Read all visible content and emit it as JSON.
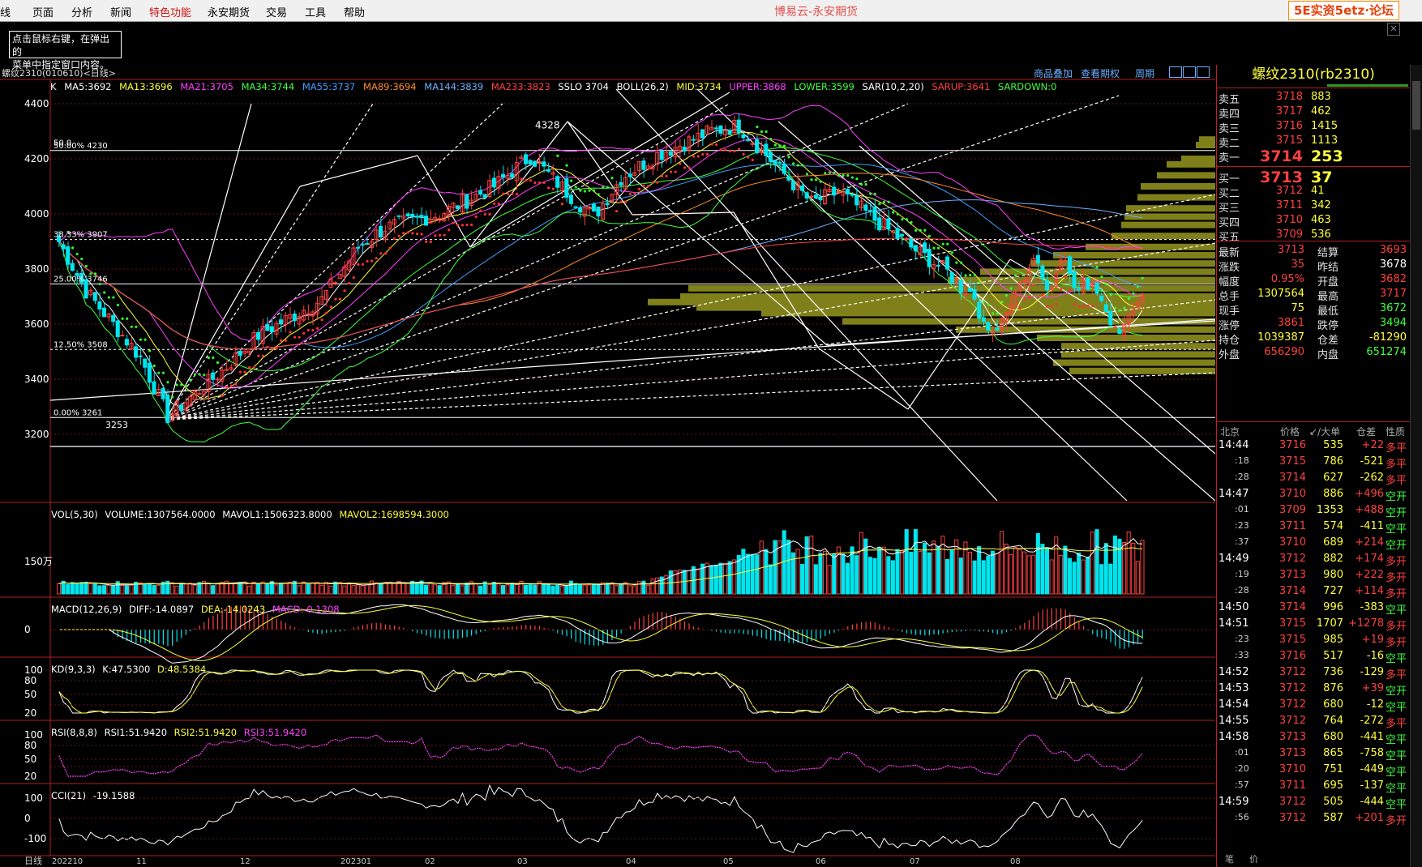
{
  "menubar": {
    "items": [
      "线",
      "页面",
      "分析",
      "新闻",
      "特色功能",
      "永安期货",
      "交易",
      "工具",
      "帮助"
    ],
    "active_item": "特色功能",
    "app_title": "博易云-永安期货",
    "watermark": "5E实资5etz·论坛"
  },
  "hint_box": {
    "line1": "点击鼠标右键，在弹出的",
    "line2": "菜单中指定窗口内容。"
  },
  "chart_header": {
    "symbol": "螺纹2310(010610)<日线>",
    "link_overlay": "商品叠加",
    "link_expiry": "查看期权",
    "link_period": "周期"
  },
  "indicators": {
    "k": "K",
    "ma5": "MA5:3692",
    "ma13": "MA13:3696",
    "ma21": "MA21:3705",
    "ma34": "MA34:3744",
    "ma55": "MA55:3737",
    "ma89": "MA89:3694",
    "ma144": "MA144:3839",
    "ma233": "MA233:3823",
    "sslo": "SSLO 3704",
    "boll": "BOLL(26,2)",
    "mid": "MID:3734",
    "upper": "UPPER:3868",
    "lower": "LOWER:3599",
    "sar": "SAR(10,2,20)",
    "sarup": "SARUP:3641",
    "sardown": "SARDOWN:0"
  },
  "colors": {
    "ma5": "#ffffff",
    "ma13": "#ffff3c",
    "ma21": "#ff40ff",
    "ma34": "#40ff40",
    "ma55": "#40a0ff",
    "ma89": "#ff8c28",
    "ma144": "#6bb0ff",
    "ma233": "#ff4040",
    "up": "#ff4040",
    "down": "#00e5ee",
    "grid": "#8b1a1a",
    "volume_profile": "#80801a"
  },
  "price_axis": {
    "ticks": [
      "4400",
      "4200",
      "4000",
      "3800",
      "3600",
      "3400",
      "3200"
    ]
  },
  "price_annotations": {
    "high": "4328",
    "low": "3253",
    "fib_50": "50.00%",
    "fib_50_val": "4230",
    "fib_50_top": "50.0",
    "fib_3833": "38.33%",
    "fib_3833_val": "3907",
    "fib_25": "25.00%",
    "fib_25_val": "3746",
    "fib_125": "12.50%",
    "fib_125_val": "3508",
    "fib_0": "0.00%",
    "fib_0_val": "3261"
  },
  "volume_pane": {
    "vol": "VOL(5,30)",
    "volume": "VOLUME:1307564.0000",
    "mavol1": "MAVOL1:1506323.8000",
    "mavol2": "MAVOL2:1698594.3000",
    "axis_label": "150万"
  },
  "macd_pane": {
    "name": "MACD(12,26,9)",
    "diff": "DIFF:-14.0897",
    "dea": "DEA:-14.0243",
    "macd": "MACD:-0.1308",
    "axis_zero": "0"
  },
  "kd_pane": {
    "name": "KD(9,3,3)",
    "k": "K:47.5300",
    "d": "D:48.5384",
    "ticks": [
      "100",
      "80",
      "50",
      "20"
    ]
  },
  "rsi_pane": {
    "name": "RSI(8,8,8)",
    "rsi1": "RSI1:51.9420",
    "rsi2": "RSI2:51.9420",
    "rsi3": "RSI3:51.9420",
    "ticks": [
      "100",
      "80",
      "50",
      "20"
    ]
  },
  "cci_pane": {
    "name": "CCI(21)",
    "value": "-19.1588",
    "ticks": [
      "100",
      "0",
      "-100"
    ]
  },
  "time_axis": {
    "first": "日线",
    "labels": [
      "202210",
      "11",
      "12",
      "202301",
      "02",
      "03",
      "04",
      "05",
      "06",
      "07",
      "08"
    ]
  },
  "quote_panel": {
    "title": "螺纹2310(rb2310)",
    "asks": [
      {
        "label": "卖五",
        "price": "3718",
        "vol": "883"
      },
      {
        "label": "卖四",
        "price": "3717",
        "vol": "462"
      },
      {
        "label": "卖三",
        "price": "3716",
        "vol": "1415"
      },
      {
        "label": "卖二",
        "price": "3715",
        "vol": "1113"
      },
      {
        "label": "卖一",
        "price": "3714",
        "vol": "253"
      }
    ],
    "bids": [
      {
        "label": "买一",
        "price": "3713",
        "vol": "37"
      },
      {
        "label": "买二",
        "price": "3712",
        "vol": "41"
      },
      {
        "label": "买三",
        "price": "3711",
        "vol": "342"
      },
      {
        "label": "买四",
        "price": "3710",
        "vol": "463"
      },
      {
        "label": "买五",
        "price": "3709",
        "vol": "536"
      }
    ],
    "stats": [
      {
        "l1": "最新",
        "v1": "3713",
        "c1": "#ff4040",
        "l2": "结算",
        "v2": "3693",
        "c2": "#ff4040"
      },
      {
        "l1": "涨跌",
        "v1": "35",
        "c1": "#ff4040",
        "l2": "昨结",
        "v2": "3678",
        "c2": "#ffffff"
      },
      {
        "l1": "幅度",
        "v1": "0.95%",
        "c1": "#ff4040",
        "l2": "开盘",
        "v2": "3682",
        "c2": "#ff4040"
      },
      {
        "l1": "总手",
        "v1": "1307564",
        "c1": "#ffff3c",
        "l2": "最高",
        "v2": "3717",
        "c2": "#ff4040"
      },
      {
        "l1": "现手",
        "v1": "75",
        "c1": "#ffff3c",
        "l2": "最低",
        "v2": "3672",
        "c2": "#40ff40"
      },
      {
        "l1": "涨停",
        "v1": "3861",
        "c1": "#ff4040",
        "l2": "跌停",
        "v2": "3494",
        "c2": "#40ff40"
      },
      {
        "l1": "持仓",
        "v1": "1039387",
        "c1": "#ffff3c",
        "l2": "仓差",
        "v2": "-81290",
        "c2": "#ffff3c"
      },
      {
        "l1": "外盘",
        "v1": "656290",
        "c1": "#ff4040",
        "l2": "内盘",
        "v2": "651274",
        "c2": "#40ff40"
      }
    ],
    "tick_header": {
      "loc": "北京",
      "price": "价格",
      "vol": "↙/大单",
      "oi": "仓差",
      "nature": "性质"
    },
    "ticks": [
      {
        "t": "14:44",
        "p": "3716",
        "v": "535",
        "o": "+22",
        "n": "多平",
        "oc": "#ff4040",
        "nc": "#ff4040"
      },
      {
        "t": ":18",
        "p": "3715",
        "v": "786",
        "o": "-521",
        "n": "多平",
        "oc": "#ffff3c",
        "nc": "#ff4040"
      },
      {
        "t": ":28",
        "p": "3714",
        "v": "627",
        "o": "-262",
        "n": "多平",
        "oc": "#ffff3c",
        "nc": "#ff4040"
      },
      {
        "t": "14:47",
        "p": "3710",
        "v": "886",
        "o": "+496",
        "n": "空开",
        "oc": "#ff4040",
        "nc": "#40ff40"
      },
      {
        "t": ":01",
        "p": "3709",
        "v": "1353",
        "o": "+488",
        "n": "空开",
        "oc": "#ff4040",
        "nc": "#40ff40"
      },
      {
        "t": ":23",
        "p": "3711",
        "v": "574",
        "o": "-411",
        "n": "空平",
        "oc": "#ffff3c",
        "nc": "#40ff40"
      },
      {
        "t": ":37",
        "p": "3710",
        "v": "689",
        "o": "+214",
        "n": "空开",
        "oc": "#ff4040",
        "nc": "#40ff40"
      },
      {
        "t": "14:49",
        "p": "3712",
        "v": "882",
        "o": "+174",
        "n": "多开",
        "oc": "#ff4040",
        "nc": "#ff4040"
      },
      {
        "t": ":19",
        "p": "3713",
        "v": "980",
        "o": "+222",
        "n": "多开",
        "oc": "#ff4040",
        "nc": "#ff4040"
      },
      {
        "t": ":28",
        "p": "3714",
        "v": "727",
        "o": "+114",
        "n": "多开",
        "oc": "#ff4040",
        "nc": "#ff4040"
      },
      {
        "t": "14:50",
        "p": "3714",
        "v": "996",
        "o": "-383",
        "n": "空平",
        "oc": "#ffff3c",
        "nc": "#40ff40"
      },
      {
        "t": "14:51",
        "p": "3715",
        "v": "1707",
        "o": "+1278",
        "n": "多开",
        "oc": "#ff4040",
        "nc": "#ff4040"
      },
      {
        "t": ":23",
        "p": "3715",
        "v": "985",
        "o": "+19",
        "n": "多开",
        "oc": "#ff4040",
        "nc": "#ff4040"
      },
      {
        "t": ":33",
        "p": "3716",
        "v": "517",
        "o": "-16",
        "n": "空平",
        "oc": "#ffff3c",
        "nc": "#40ff40"
      },
      {
        "t": "14:52",
        "p": "3712",
        "v": "736",
        "o": "-129",
        "n": "多平",
        "oc": "#ffff3c",
        "nc": "#ff4040"
      },
      {
        "t": "14:53",
        "p": "3712",
        "v": "876",
        "o": "+39",
        "n": "空开",
        "oc": "#ff4040",
        "nc": "#40ff40"
      },
      {
        "t": "14:54",
        "p": "3712",
        "v": "680",
        "o": "-12",
        "n": "空平",
        "oc": "#ffff3c",
        "nc": "#40ff40"
      },
      {
        "t": "14:55",
        "p": "3712",
        "v": "764",
        "o": "-272",
        "n": "多平",
        "oc": "#ffff3c",
        "nc": "#ff4040"
      },
      {
        "t": "14:58",
        "p": "3713",
        "v": "680",
        "o": "-441",
        "n": "空平",
        "oc": "#ffff3c",
        "nc": "#40ff40"
      },
      {
        "t": ":01",
        "p": "3713",
        "v": "865",
        "o": "-758",
        "n": "空平",
        "oc": "#ffff3c",
        "nc": "#40ff40"
      },
      {
        "t": ":20",
        "p": "3710",
        "v": "751",
        "o": "-449",
        "n": "空平",
        "oc": "#ffff3c",
        "nc": "#40ff40"
      },
      {
        "t": ":57",
        "p": "3711",
        "v": "695",
        "o": "-137",
        "n": "空平",
        "oc": "#ffff3c",
        "nc": "#40ff40"
      },
      {
        "t": "14:59",
        "p": "3712",
        "v": "505",
        "o": "-444",
        "n": "空平",
        "oc": "#ffff3c",
        "nc": "#40ff40"
      },
      {
        "t": ":56",
        "p": "3712",
        "v": "587",
        "o": "+201",
        "n": "多开",
        "oc": "#ff4040",
        "nc": "#ff4040"
      }
    ],
    "bottom_tabs": [
      "笔",
      "价"
    ]
  }
}
